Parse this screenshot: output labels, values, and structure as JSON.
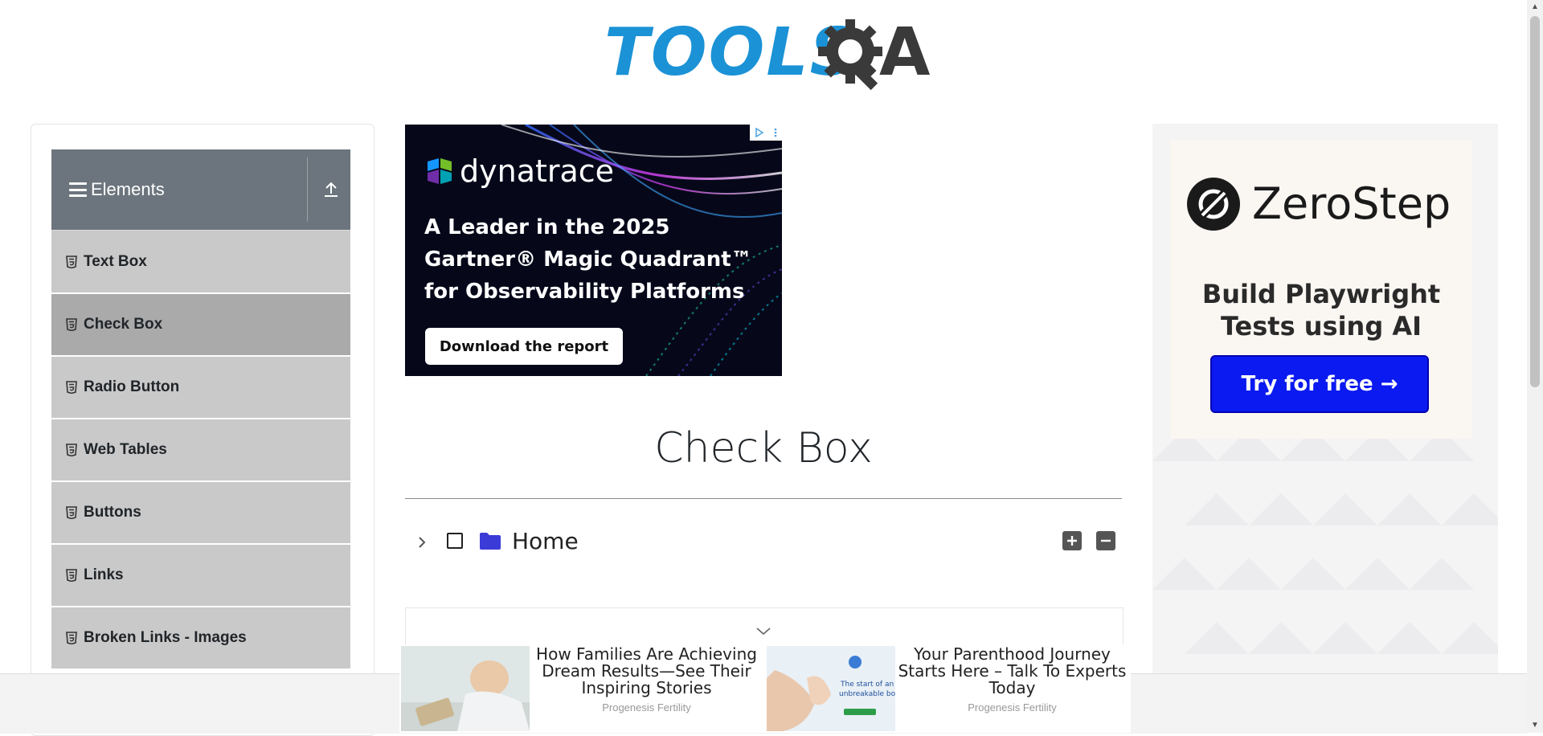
{
  "logo": {
    "part1": "TOOLS",
    "part3": "A"
  },
  "sidebar": {
    "group_title": "Elements",
    "items": [
      {
        "label": "Text Box",
        "active": false
      },
      {
        "label": "Check Box",
        "active": true
      },
      {
        "label": "Radio Button",
        "active": false
      },
      {
        "label": "Web Tables",
        "active": false
      },
      {
        "label": "Buttons",
        "active": false
      },
      {
        "label": "Links",
        "active": false
      },
      {
        "label": "Broken Links - Images",
        "active": false
      }
    ]
  },
  "top_ad": {
    "brand": "dynatrace",
    "headline_lines": [
      "A Leader in the 2025",
      "Gartner® Magic Quadrant™",
      "for Observability Platforms"
    ],
    "cta": "Download the report"
  },
  "main": {
    "title": "Check Box",
    "tree": {
      "root_label": "Home"
    }
  },
  "right_ad": {
    "brand": "ZeroStep",
    "subtitle_lines": [
      "Build Playwright",
      "Tests using AI"
    ],
    "cta": "Try for free →",
    "cta_color": "#0a1af0"
  },
  "bottom_ads": [
    {
      "headline": "How Families Are Achieving Dream Results—See Their Inspiring Stories",
      "source": "Progenesis Fertility"
    },
    {
      "headline": "Your Parenthood Journey Starts Here – Talk To Experts Today",
      "source": "Progenesis Fertility"
    }
  ],
  "colors": {
    "logo_blue": "#1b92d6",
    "sidebar_header": "#6c757d",
    "menu_item": "#c9c9c9",
    "menu_active": "#aaaaaa",
    "folder": "#3b3bd8"
  }
}
